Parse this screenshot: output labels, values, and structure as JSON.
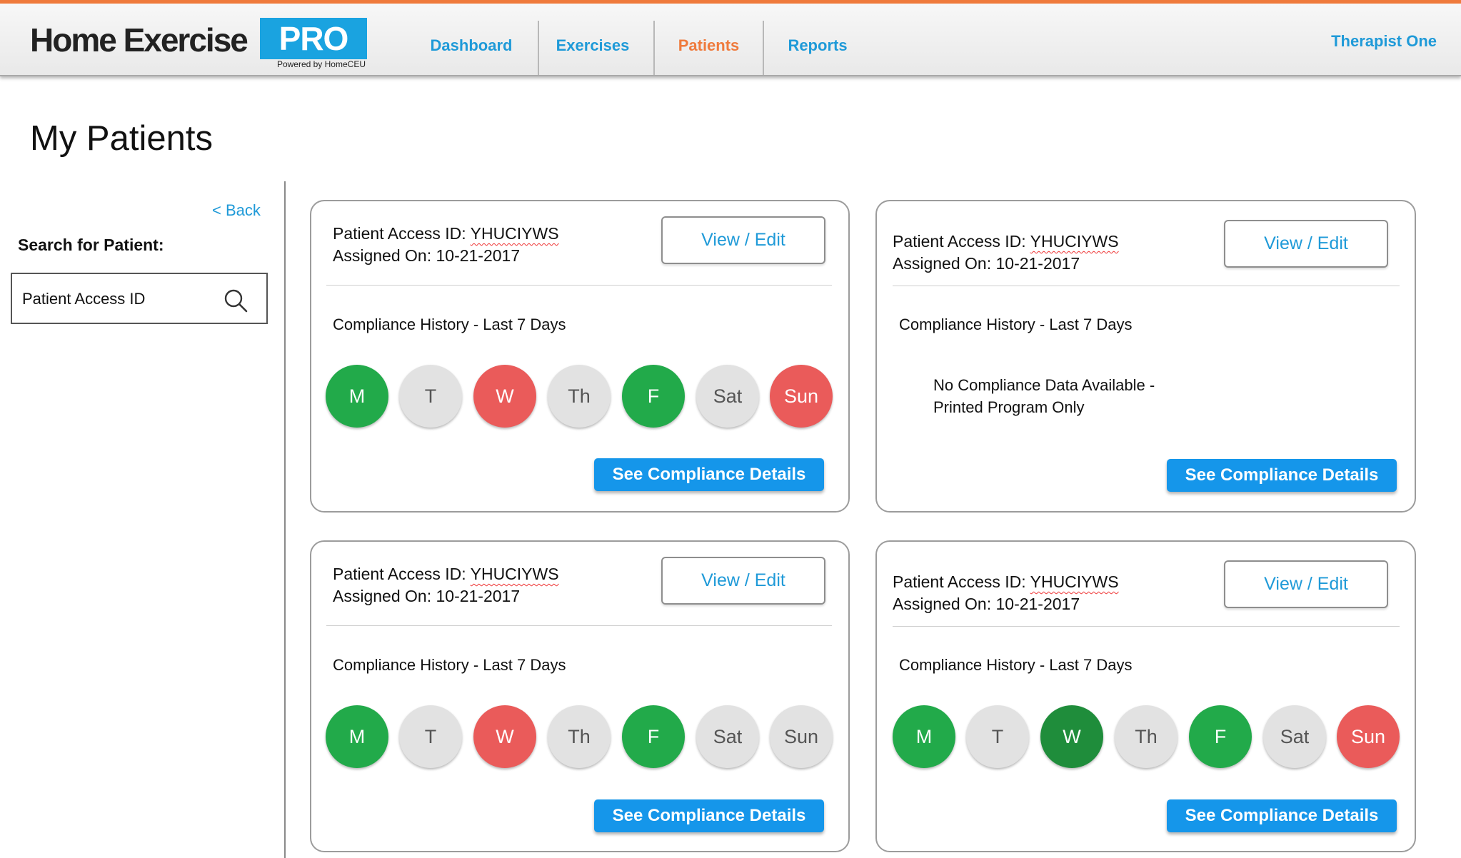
{
  "header": {
    "logo_main": "Home Exercise",
    "logo_pro": "PRO",
    "logo_sub": "Powered by HomeCEU",
    "nav": [
      {
        "label": "Dashboard",
        "active": false
      },
      {
        "label": "Exercises",
        "active": false
      },
      {
        "label": "Patients",
        "active": true
      },
      {
        "label": "Reports",
        "active": false
      }
    ],
    "user": "Therapist One",
    "accent_color": "#ef7a3c",
    "link_color": "#1f9ad8"
  },
  "page": {
    "title": "My Patients"
  },
  "sidebar": {
    "back_label": "< Back",
    "search_label": "Search for Patient:",
    "search_placeholder": "Patient Access ID",
    "search_icon": "search-icon"
  },
  "cards": [
    {
      "access_id_label": "Patient Access ID:",
      "access_id": "YHUCIYWS",
      "assigned_label": "Assigned On:",
      "assigned_on": "10-21-2017",
      "view_label": "View / Edit",
      "history_title": "Compliance History - Last 7 Days",
      "days": [
        {
          "label": "M",
          "status": "green"
        },
        {
          "label": "T",
          "status": "gray"
        },
        {
          "label": "W",
          "status": "red"
        },
        {
          "label": "Th",
          "status": "gray"
        },
        {
          "label": "F",
          "status": "green"
        },
        {
          "label": "Sat",
          "status": "gray"
        },
        {
          "label": "Sun",
          "status": "red"
        }
      ],
      "details_label": "See Compliance Details"
    },
    {
      "access_id_label": "Patient Access ID:",
      "access_id": "YHUCIYWS",
      "assigned_label": "Assigned On:",
      "assigned_on": "10-21-2017",
      "view_label": "View / Edit",
      "history_title": "Compliance History - Last 7 Days",
      "no_data_line1": "No Compliance Data Available -",
      "no_data_line2": "Printed Program Only",
      "details_label": "See Compliance Details"
    },
    {
      "access_id_label": "Patient Access ID:",
      "access_id": "YHUCIYWS",
      "assigned_label": "Assigned On:",
      "assigned_on": "10-21-2017",
      "view_label": "View / Edit",
      "history_title": "Compliance History - Last 7 Days",
      "days": [
        {
          "label": "M",
          "status": "green"
        },
        {
          "label": "T",
          "status": "gray"
        },
        {
          "label": "W",
          "status": "red"
        },
        {
          "label": "Th",
          "status": "gray"
        },
        {
          "label": "F",
          "status": "green"
        },
        {
          "label": "Sat",
          "status": "gray"
        },
        {
          "label": "Sun",
          "status": "gray"
        }
      ],
      "details_label": "See Compliance Details"
    },
    {
      "access_id_label": "Patient Access ID:",
      "access_id": "YHUCIYWS",
      "assigned_label": "Assigned On:",
      "assigned_on": "10-21-2017",
      "view_label": "View / Edit",
      "history_title": "Compliance History - Last 7 Days",
      "days": [
        {
          "label": "M",
          "status": "green"
        },
        {
          "label": "T",
          "status": "gray"
        },
        {
          "label": "W",
          "status": "dark"
        },
        {
          "label": "Th",
          "status": "gray"
        },
        {
          "label": "F",
          "status": "green"
        },
        {
          "label": "Sat",
          "status": "gray"
        },
        {
          "label": "Sun",
          "status": "red"
        }
      ],
      "details_label": "See Compliance Details"
    }
  ]
}
